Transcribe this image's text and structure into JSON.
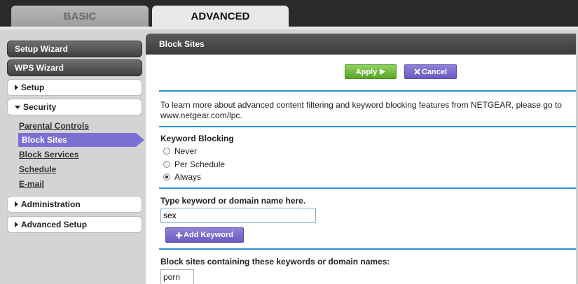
{
  "tabs": {
    "basic": "BASIC",
    "advanced": "ADVANCED"
  },
  "sidebar": {
    "setup_wizard": "Setup Wizard",
    "wps_wizard": "WPS Wizard",
    "setup": "Setup",
    "security": "Security",
    "security_items": [
      "Parental Controls",
      "Block Sites",
      "Block Services",
      "Schedule",
      "E-mail"
    ],
    "active_item": "Block Sites",
    "administration": "Administration",
    "advanced_setup": "Advanced Setup"
  },
  "page": {
    "title": "Block Sites",
    "apply_label": "Apply",
    "cancel_label": "Cancel",
    "info_text": "To learn more about advanced content filtering and keyword blocking features from NETGEAR, please go to www.netgear.com/lpc.",
    "keyword_blocking_label": "Keyword Blocking",
    "options": [
      "Never",
      "Per Schedule",
      "Always"
    ],
    "selected_option": "Always",
    "keyword_prompt": "Type keyword or domain name here.",
    "keyword_value": "sex",
    "add_keyword_label": "Add Keyword",
    "block_list_label": "Block sites containing these keywords or domain names:",
    "block_list": [
      "porn"
    ]
  },
  "colors": {
    "accent_blue": "#2e8fcf",
    "apply_green": "#5aa52a",
    "purple": "#7b6fd1"
  },
  "icons": {
    "apply": "triangle-right-icon",
    "cancel": "x-icon",
    "add": "plus-icon"
  }
}
